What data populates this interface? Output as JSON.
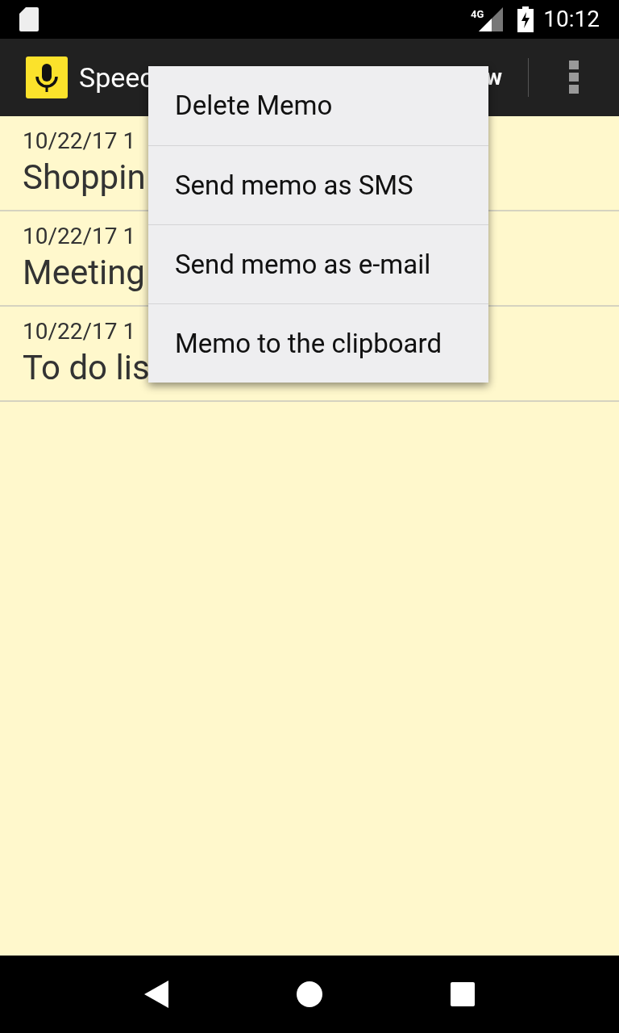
{
  "status_bar": {
    "network": "4G",
    "time": "10:12"
  },
  "toolbar": {
    "title": "Speec",
    "action": "w"
  },
  "memos": [
    {
      "date": "10/22/17 1",
      "title": "Shoppin"
    },
    {
      "date": "10/22/17 1",
      "title": "Meeting"
    },
    {
      "date": "10/22/17 1",
      "title": "To do lis"
    }
  ],
  "context_menu": [
    "Delete Memo",
    "Send memo as SMS",
    "Send memo as e-mail",
    "Memo to the clipboard"
  ]
}
